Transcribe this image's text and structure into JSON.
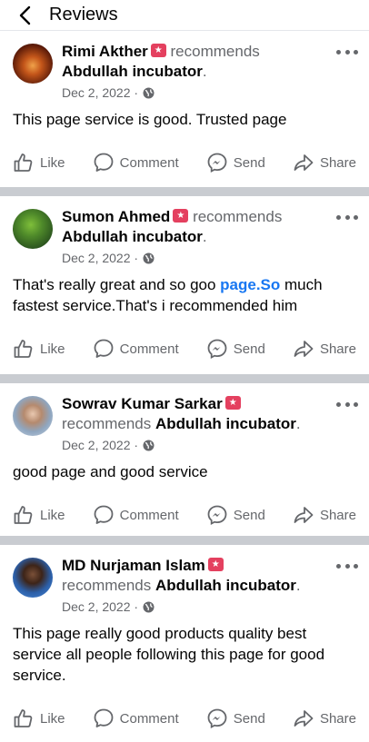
{
  "header": {
    "title": "Reviews"
  },
  "recommends_text": "recommends",
  "actions": {
    "like": "Like",
    "comment": "Comment",
    "send": "Send",
    "share": "Share"
  },
  "reviews": [
    {
      "author": "Rimi Akther",
      "page": "Abdullah incubator",
      "date": "Dec 2, 2022 · ",
      "text_parts": [
        "This page service is good. Trusted page"
      ]
    },
    {
      "author": "Sumon Ahmed",
      "page": "Abdullah incubator",
      "date": "Dec 2, 2022 · ",
      "text_parts": [
        "That's really great and so goo ",
        "page.So",
        " much fastest service.That's i recommended him"
      ]
    },
    {
      "author": "Sowrav Kumar Sarkar",
      "page": "Abdullah incubator",
      "date": "Dec 2, 2022 · ",
      "text_parts": [
        "good page and good service"
      ]
    },
    {
      "author": "MD Nurjaman Islam",
      "page": "Abdullah incubator",
      "date": "Dec 2, 2022 · ",
      "text_parts": [
        "This page really good products quality best service all people following this page for good service."
      ]
    }
  ]
}
